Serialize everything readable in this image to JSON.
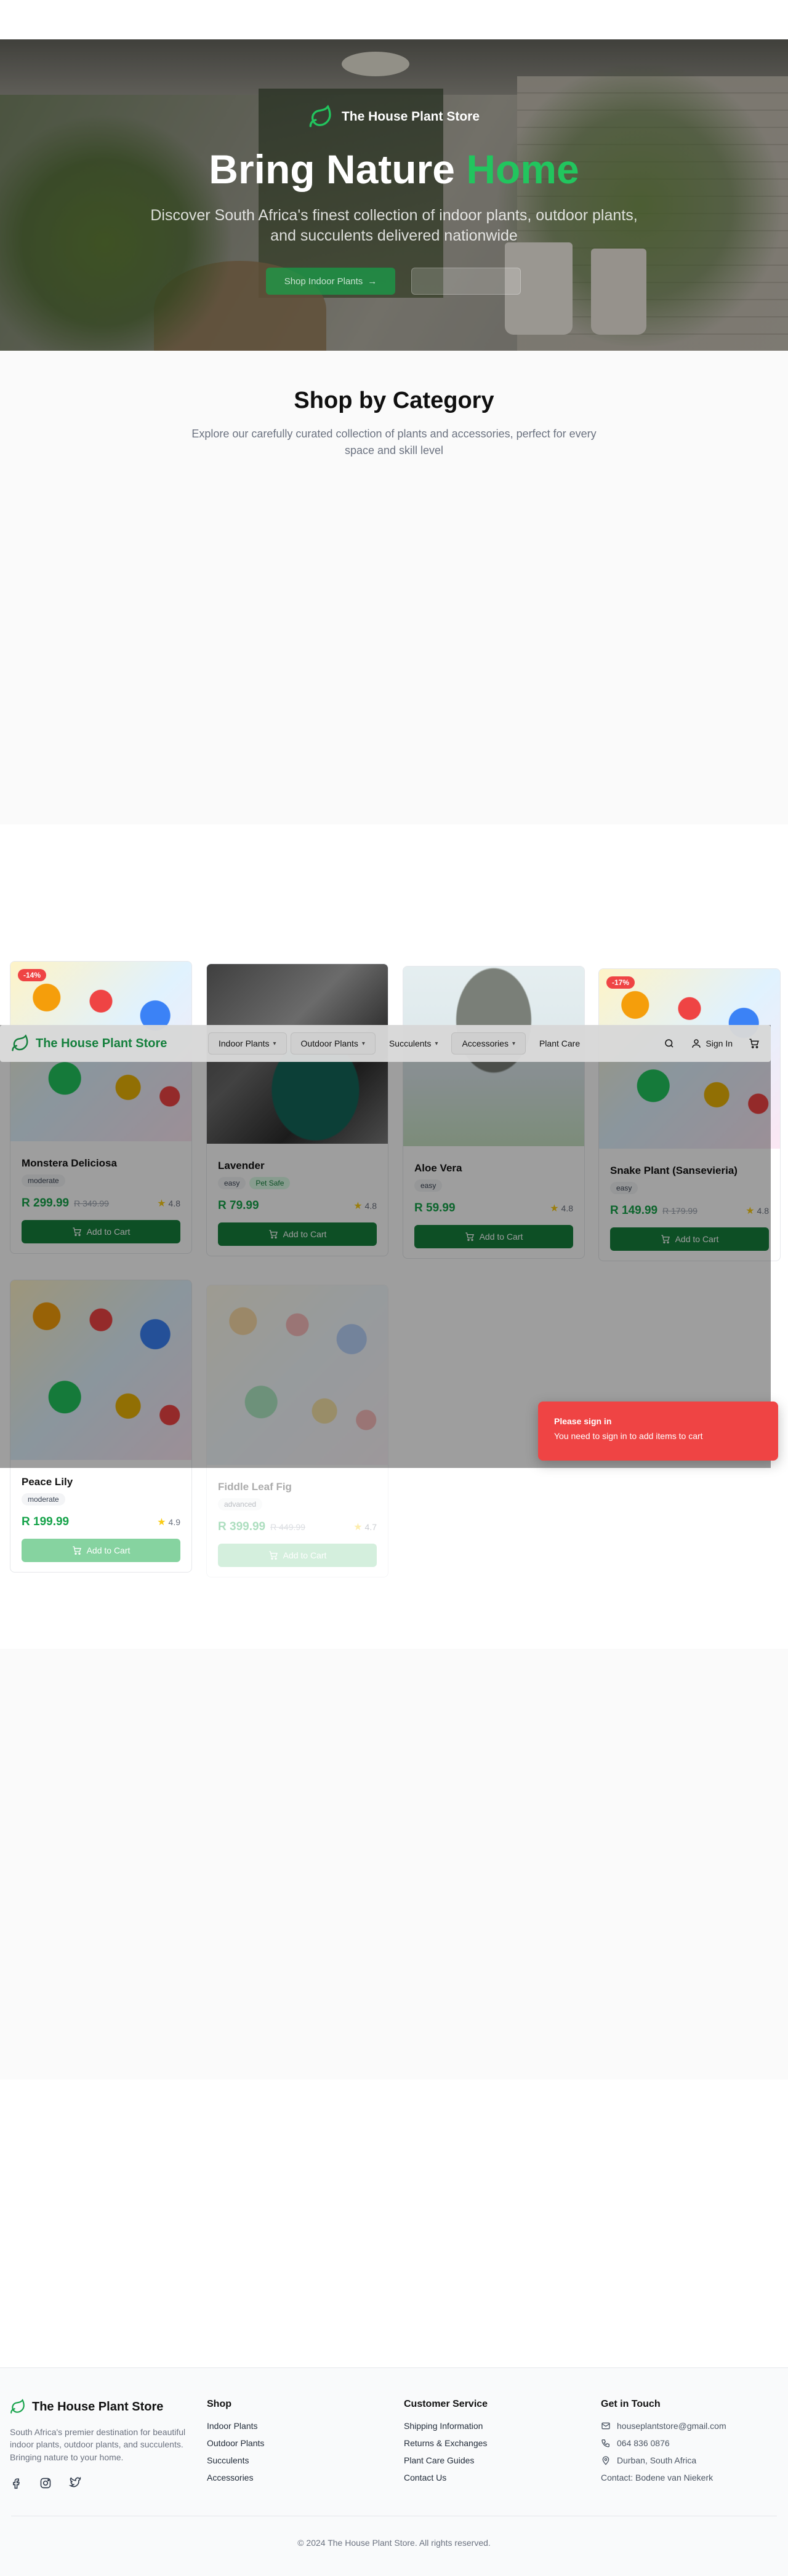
{
  "brand": {
    "name": "The House Plant Store",
    "accent_color": "#22c55e",
    "primary_color": "#15803d"
  },
  "hero": {
    "title_main": "Bring Nature",
    "title_accent": "Home",
    "subtitle": "Discover South Africa's finest collection of indoor plants, outdoor plants, and succulents delivered nationwide",
    "primary_button": "Shop Indoor Plants",
    "secondary_button": ""
  },
  "category": {
    "title": "Shop by Category",
    "subtitle": "Explore our carefully curated collection of plants and accessories, perfect for every space and skill level"
  },
  "nav": {
    "items": [
      {
        "label": "Indoor Plants",
        "dropdown": true
      },
      {
        "label": "Outdoor Plants",
        "dropdown": true
      },
      {
        "label": "Succulents",
        "dropdown": true
      },
      {
        "label": "Accessories",
        "dropdown": true
      },
      {
        "label": "Plant Care",
        "dropdown": false
      }
    ],
    "sign_in": "Sign In"
  },
  "products": [
    {
      "name": "Monstera Deliciosa",
      "tags": [
        "moderate"
      ],
      "price": "R 299.99",
      "old_price": "R 349.99",
      "rating": "4.8",
      "discount": "-14%",
      "button": "Add to Cart"
    },
    {
      "name": "Lavender",
      "tags": [
        "easy",
        "Pet Safe"
      ],
      "price": "R 79.99",
      "old_price": "",
      "rating": "4.8",
      "discount": "",
      "button": "Add to Cart"
    },
    {
      "name": "Aloe Vera",
      "tags": [
        "easy"
      ],
      "price": "R 59.99",
      "old_price": "",
      "rating": "4.8",
      "discount": "",
      "button": "Add to Cart"
    },
    {
      "name": "Snake Plant (Sansevieria)",
      "tags": [
        "easy"
      ],
      "price": "R 149.99",
      "old_price": "R 179.99",
      "rating": "4.8",
      "discount": "-17%",
      "button": "Add to Cart"
    },
    {
      "name": "Peace Lily",
      "tags": [
        "moderate"
      ],
      "price": "R 199.99",
      "old_price": "",
      "rating": "4.9",
      "discount": "",
      "button": "Add to Cart"
    },
    {
      "name": "Fiddle Leaf Fig",
      "tags": [
        "advanced"
      ],
      "price": "R 399.99",
      "old_price": "R 449.99",
      "rating": "4.7",
      "discount": "",
      "button": "Add to Cart"
    }
  ],
  "toast": {
    "title": "Please sign in",
    "message": "You need to sign in to add items to cart"
  },
  "footer": {
    "description": "South Africa's premier destination for beautiful indoor plants, outdoor plants, and succulents. Bringing nature to your home.",
    "shop_heading": "Shop",
    "shop_links": [
      "Indoor Plants",
      "Outdoor Plants",
      "Succulents",
      "Accessories"
    ],
    "service_heading": "Customer Service",
    "service_links": [
      "Shipping Information",
      "Returns & Exchanges",
      "Plant Care Guides",
      "Contact Us"
    ],
    "contact_heading": "Get in Touch",
    "email": "houseplantstore@gmail.com",
    "phone": "064 836 0876",
    "location": "Durban, South Africa",
    "contact_person": "Contact: Bodene van Niekerk",
    "copyright": "© 2024 The House Plant Store. All rights reserved."
  }
}
